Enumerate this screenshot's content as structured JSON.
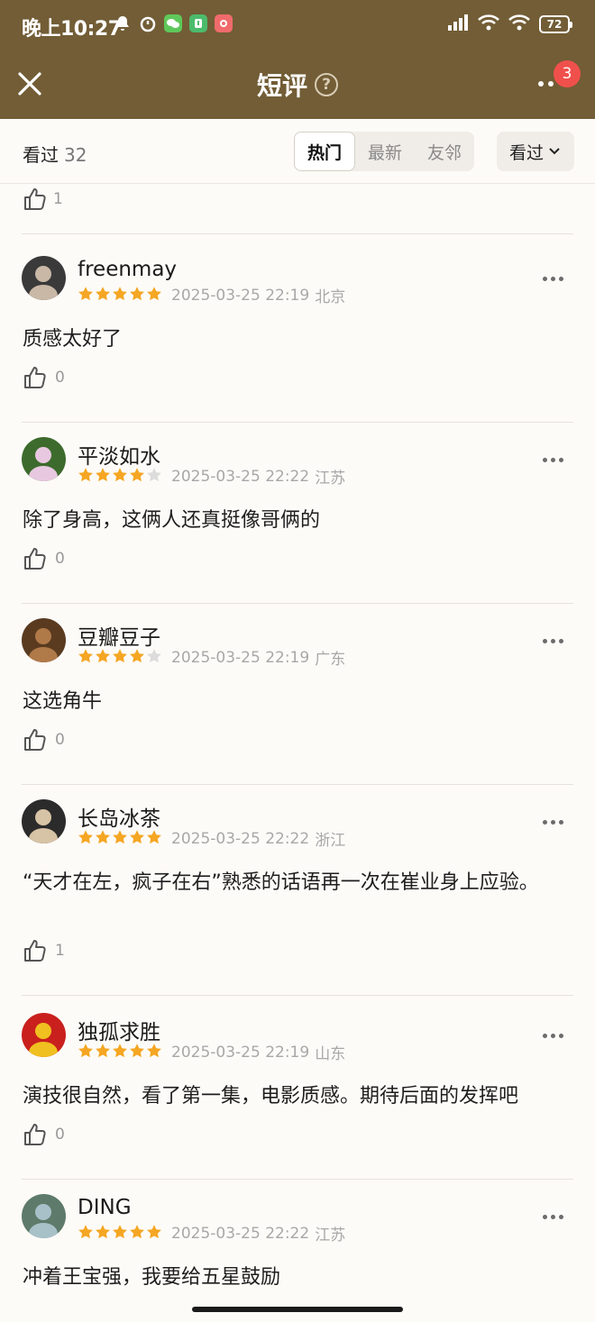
{
  "status_bar": {
    "time": "晚上10:27",
    "battery": "72"
  },
  "header": {
    "title": "短评",
    "help_glyph": "?",
    "badge_count": "3"
  },
  "filter": {
    "watched_label": "看过",
    "watched_count": "32",
    "tabs": [
      "热门",
      "最新",
      "友邻"
    ],
    "active_tab": "热门",
    "dropdown_label": "看过"
  },
  "top_partial_like": "1",
  "reviews": [
    {
      "user": "freenmay",
      "rating": 5,
      "time": "2025-03-25 22:19",
      "location": "北京",
      "text": "质感太好了",
      "likes": "0"
    },
    {
      "user": "平淡如水",
      "rating": 4,
      "time": "2025-03-25 22:22",
      "location": "江苏",
      "text": "除了身高，这俩人还真挺像哥俩的",
      "likes": "0"
    },
    {
      "user": "豆瓣豆子",
      "rating": 4,
      "time": "2025-03-25 22:19",
      "location": "广东",
      "text": "这选角牛",
      "likes": "0"
    },
    {
      "user": "长岛冰茶",
      "rating": 5,
      "time": "2025-03-25 22:22",
      "location": "浙江",
      "text": "“天才在左，疯子在右”熟悉的话语再一次在崔业身上应验。",
      "likes": "1"
    },
    {
      "user": "独孤求胜",
      "rating": 5,
      "time": "2025-03-25 22:19",
      "location": "山东",
      "text": "演技很自然，看了第一集，电影质感。期待后面的发挥吧",
      "likes": "0"
    },
    {
      "user": "DING",
      "rating": 5,
      "time": "2025-03-25 22:22",
      "location": "江苏",
      "text": "冲着王宝强，我要给五星鼓励",
      "likes": ""
    }
  ],
  "colors": {
    "header_bg": "#725d36",
    "star_on": "#f5a623",
    "star_off": "#dcdcdc",
    "badge": "#f0504b"
  }
}
